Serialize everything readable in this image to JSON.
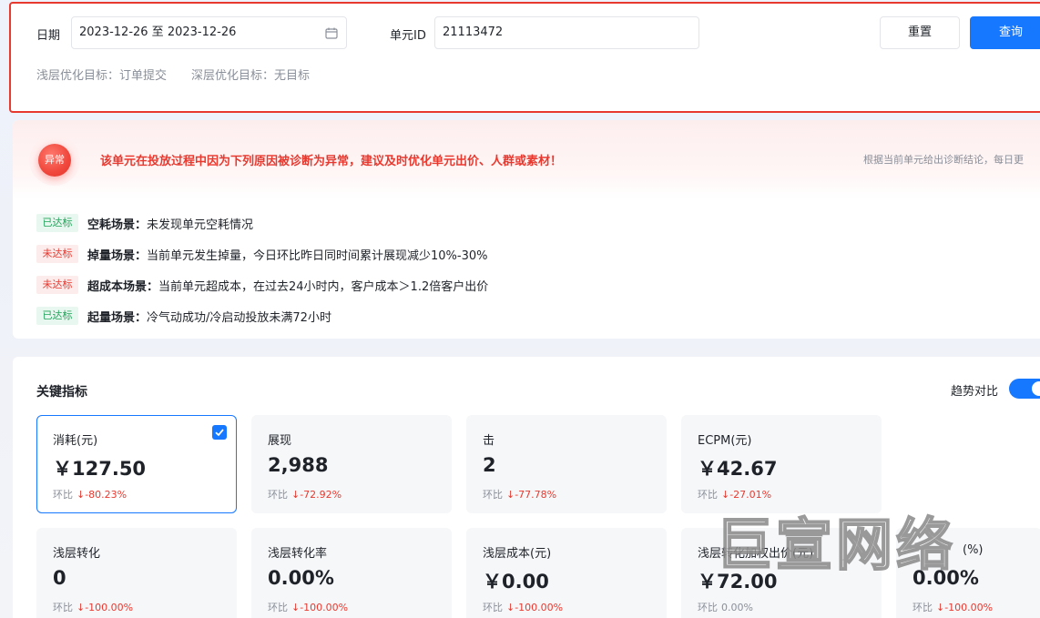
{
  "filter": {
    "date_label": "日期",
    "date_value": "2023-12-26 至 2023-12-26",
    "unit_label": "单元ID",
    "unit_value": "21113472",
    "reset_label": "重置",
    "query_label": "查询",
    "shallow_goal_label": "浅层优化目标：",
    "shallow_goal_value": "订单提交",
    "deep_goal_label": "深层优化目标：",
    "deep_goal_value": "无目标"
  },
  "diagnosis": {
    "badge": "异常",
    "message": "该单元在投放过程中因为下列原因被诊断为异常，建议及时优化单元出价、人群或素材！",
    "hint": "根据当前单元给出诊断结论，每日更",
    "scenes": [
      {
        "status": "已达标",
        "ok": true,
        "name": "空耗场景：",
        "desc": "未发现单元空耗情况"
      },
      {
        "status": "未达标",
        "ok": false,
        "name": "掉量场景：",
        "desc": "当前单元发生掉量，今日环比昨日同时间累计展现减少10%-30%"
      },
      {
        "status": "未达标",
        "ok": false,
        "name": "超成本场景：",
        "desc": "当前单元超成本，在过去24小时内，客户成本＞1.2倍客户出价"
      },
      {
        "status": "已达标",
        "ok": true,
        "name": "起量场景：",
        "desc": "冷气动成功/冷启动投放未满72小时"
      }
    ]
  },
  "metrics": {
    "title": "关键指标",
    "trend_label": "趋势对比",
    "compare_label": "环比",
    "cards": [
      {
        "label": "消耗(元)",
        "value": "￥127.50",
        "delta": "↓-80.23%",
        "selected": true
      },
      {
        "label": "展现",
        "value": "2,988",
        "delta": "↓-72.92%"
      },
      {
        "label": "击",
        "value": "2",
        "delta": "↓-77.78%"
      },
      {
        "label": "ECPM(元)",
        "value": "￥42.67",
        "delta": "↓-27.01%"
      },
      {
        "label": "浅层转化",
        "value": "0",
        "delta": "↓-100.00%"
      },
      {
        "label": "浅层转化率",
        "value": "0.00%",
        "delta": "↓-100.00%"
      },
      {
        "label": "浅层成本(元)",
        "value": "￥0.00",
        "delta": "↓-100.00%"
      },
      {
        "label": "浅层转化加权出价(元)",
        "value": "￥72.00",
        "delta": "0.00%",
        "flat": true
      },
      {
        "label": "(%)",
        "value": "0.00%",
        "delta": "↓-100.00%"
      }
    ]
  },
  "watermark": "巨宣网络",
  "colors": {
    "accent": "#1677ff",
    "danger": "#e8392f",
    "success": "#22a55a"
  }
}
